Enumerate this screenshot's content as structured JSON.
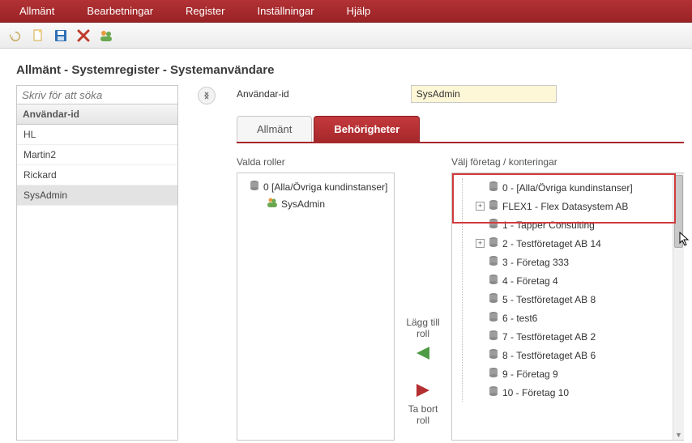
{
  "menubar": [
    "Allmänt",
    "Bearbetningar",
    "Register",
    "Inställningar",
    "Hjälp"
  ],
  "breadcrumb": "Allmänt - Systemregister - Systemanvändare",
  "search_placeholder": "Skriv för att söka",
  "grid_header": "Användar-id",
  "user_rows": [
    "HL",
    "Martin2",
    "Rickard",
    "SysAdmin"
  ],
  "selected_user_index": 3,
  "form": {
    "user_id_label": "Användar-id",
    "user_id_value": "SysAdmin"
  },
  "tabs": {
    "general": "Allmänt",
    "permissions": "Behörigheter"
  },
  "roles": {
    "label": "Valda roller",
    "root": "0 [Alla/Övriga kundinstanser]",
    "child": "SysAdmin"
  },
  "actions": {
    "add_label": "Lägg till roll",
    "remove_label": "Ta bort roll"
  },
  "companies": {
    "label": "Välj företag / konteringar",
    "items": [
      {
        "id": "0",
        "name": "[Alla/Övriga kundinstanser]",
        "expandable": false
      },
      {
        "id": "FLEX1",
        "name": "Flex Datasystem AB",
        "expandable": true
      },
      {
        "id": "1",
        "name": "Tapper Consulting",
        "expandable": false
      },
      {
        "id": "2",
        "name": "Testföretaget AB 14",
        "expandable": true
      },
      {
        "id": "3",
        "name": "Företag 333",
        "expandable": false
      },
      {
        "id": "4",
        "name": "Företag 4",
        "expandable": false
      },
      {
        "id": "5",
        "name": "Testföretaget AB 8",
        "expandable": false
      },
      {
        "id": "6",
        "name": "test6",
        "expandable": false
      },
      {
        "id": "7",
        "name": "Testföretaget AB 2",
        "expandable": false
      },
      {
        "id": "8",
        "name": "Testföretaget AB 6",
        "expandable": false
      },
      {
        "id": "9",
        "name": "Företag 9",
        "expandable": false
      },
      {
        "id": "10",
        "name": "Företag 10",
        "expandable": false
      }
    ]
  }
}
